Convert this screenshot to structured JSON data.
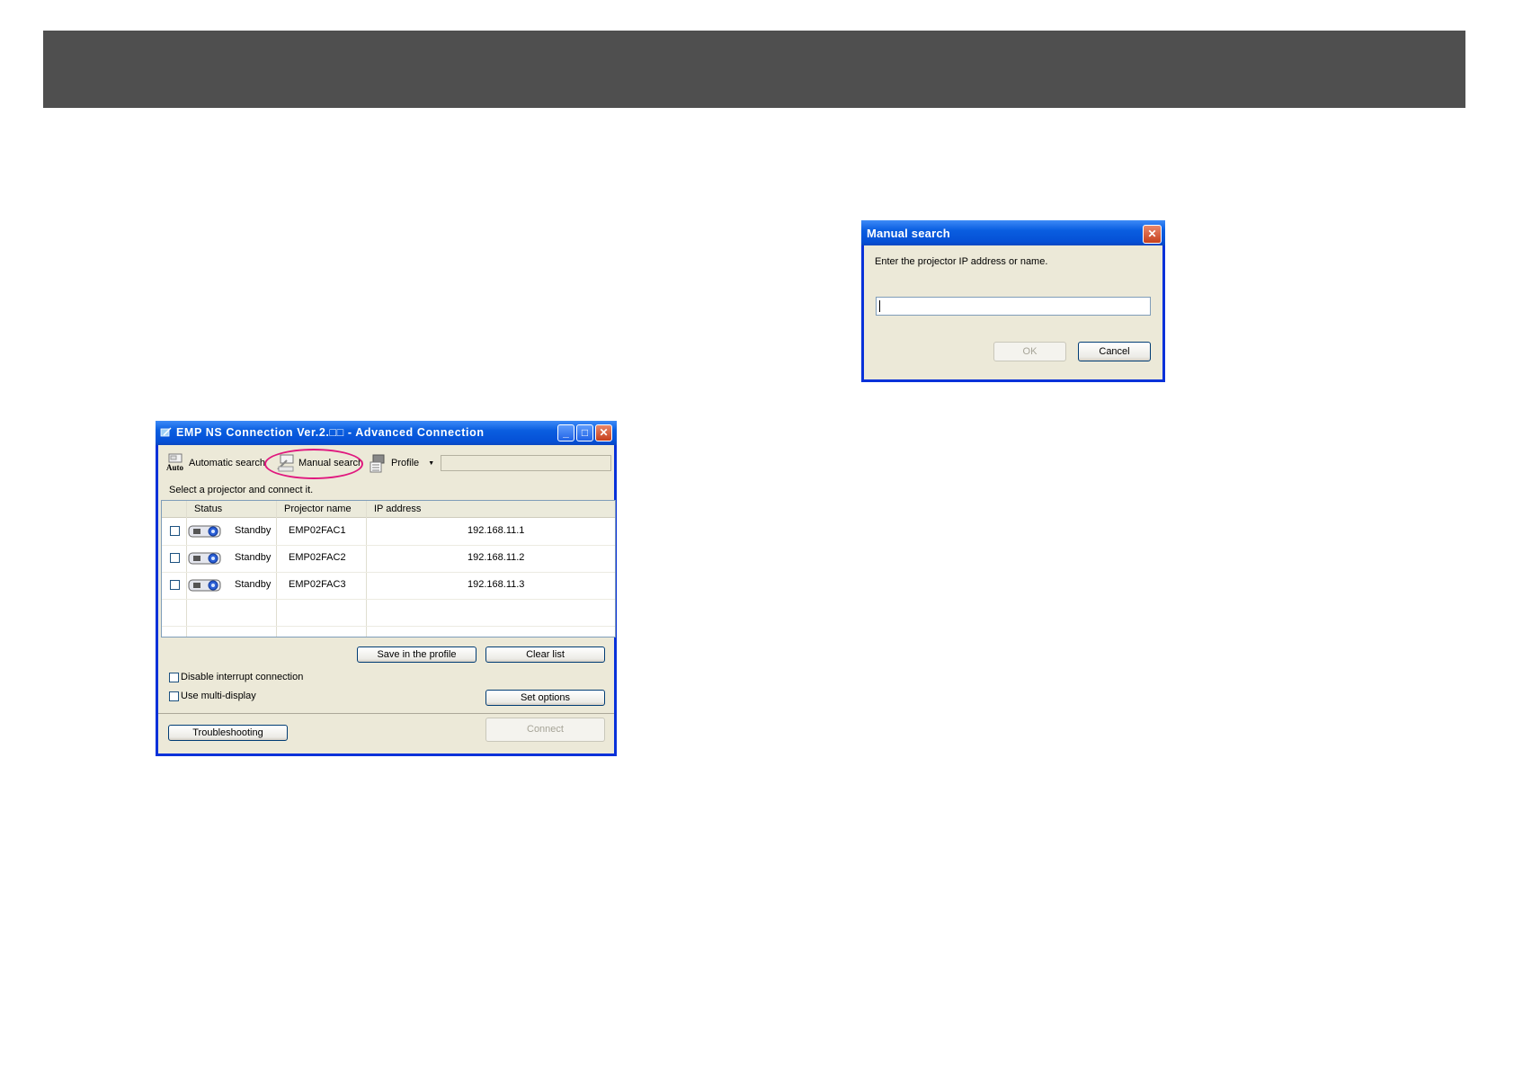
{
  "main_window": {
    "title": "EMP NS Connection Ver.2.□□ - Advanced Connection",
    "toolbar": {
      "auto_icon_label": "Auto",
      "automatic_search": "Automatic search",
      "manual_search": "Manual search",
      "profile": "Profile",
      "profile_value": ""
    },
    "instruction": "Select a projector and connect it.",
    "columns": [
      "Status",
      "Projector name",
      "IP address"
    ],
    "rows": [
      {
        "status": "Standby",
        "name": "EMP02FAC1",
        "ip": "192.168.11.1"
      },
      {
        "status": "Standby",
        "name": "EMP02FAC2",
        "ip": "192.168.11.2"
      },
      {
        "status": "Standby",
        "name": "EMP02FAC3",
        "ip": "192.168.11.3"
      }
    ],
    "buttons": {
      "save_profile": "Save in the profile",
      "clear_list": "Clear list",
      "set_options": "Set options",
      "troubleshooting": "Troubleshooting",
      "connect": "Connect"
    },
    "checkboxes": {
      "disable_interrupt": "Disable interrupt connection",
      "multi_display": "Use multi-display"
    }
  },
  "dialog": {
    "title": "Manual search",
    "prompt": "Enter the projector IP address or name.",
    "input_value": "",
    "ok": "OK",
    "cancel": "Cancel"
  },
  "colors": {
    "header_bar": "#4f4f4f",
    "highlight_ellipse": "#e0187e",
    "xp_title_blue": "#0a5ee0",
    "window_face": "#ece9d8"
  }
}
